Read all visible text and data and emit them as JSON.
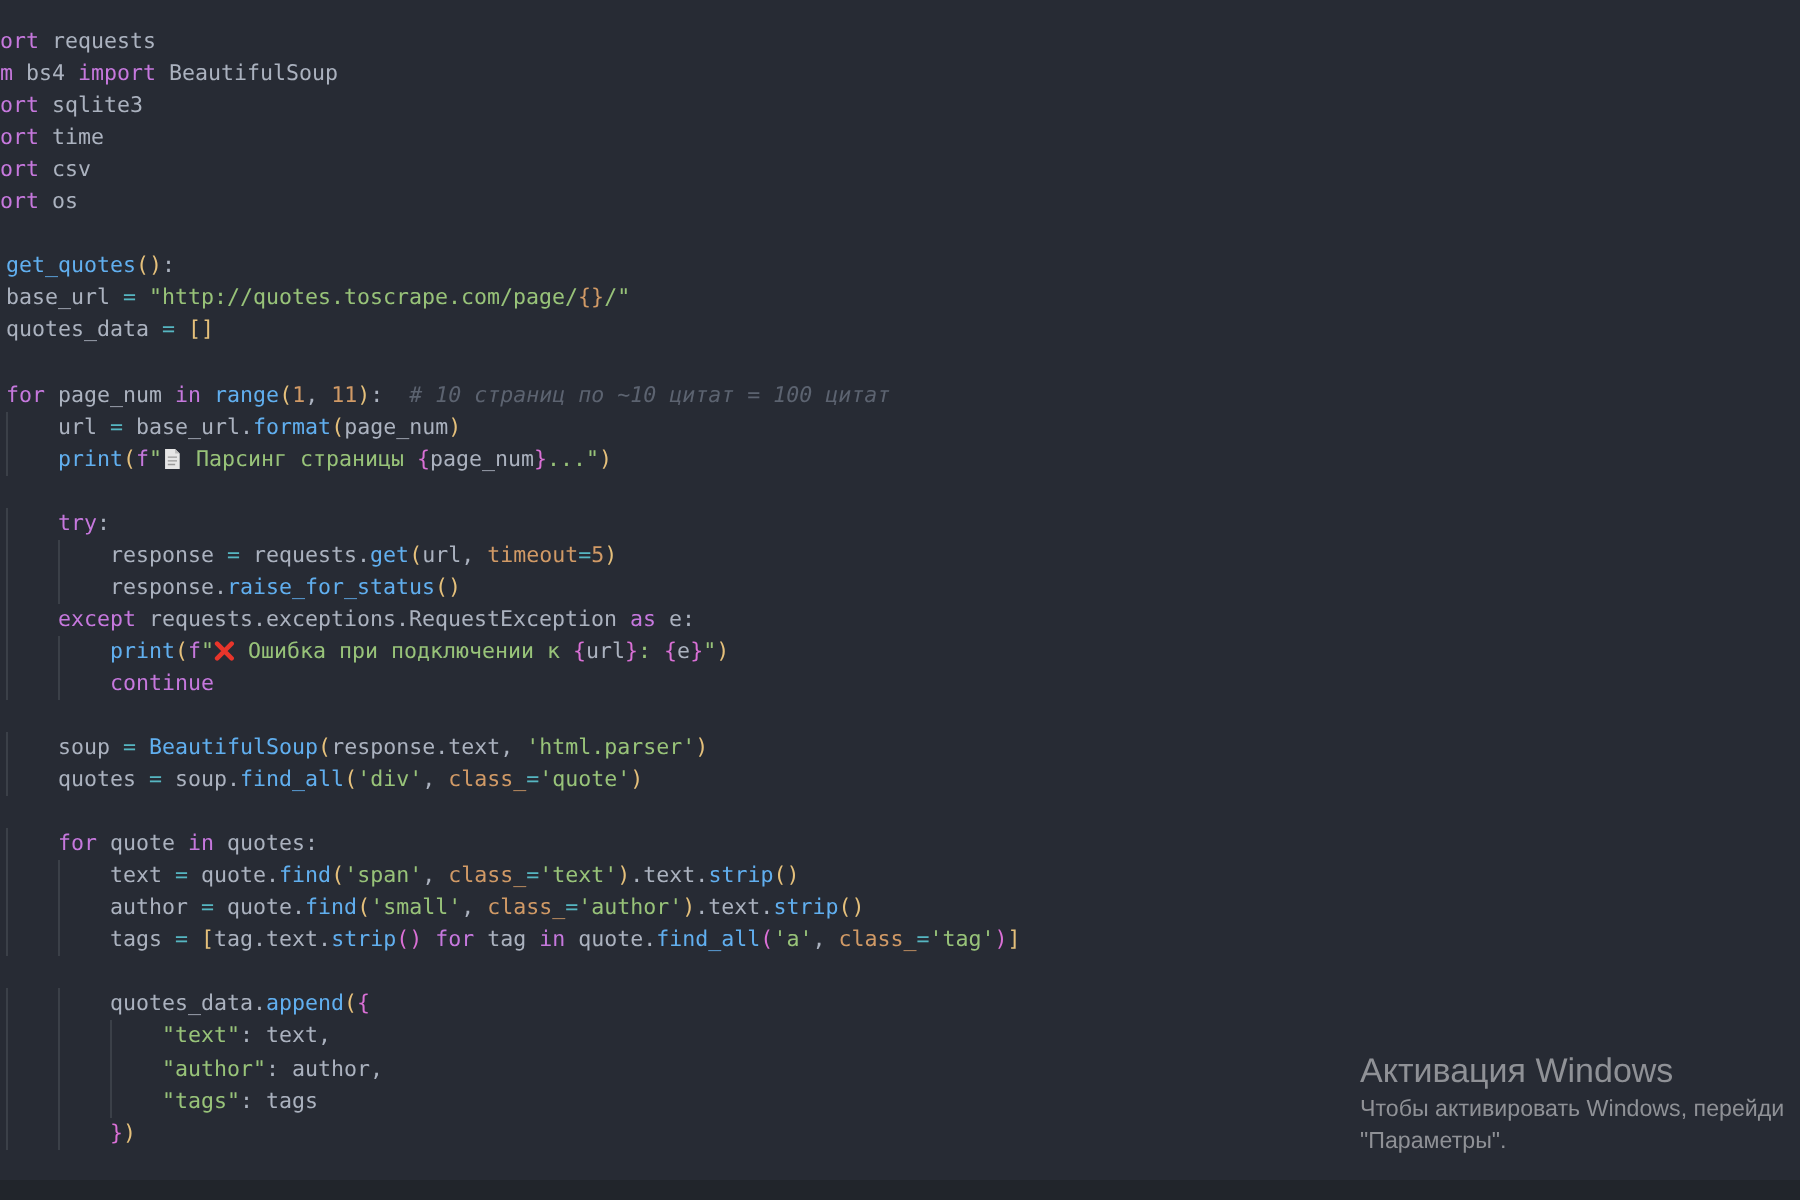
{
  "editor": {
    "lines": [
      {
        "kind": "clipped",
        "tokens": [
          {
            "kind": "k",
            "text": "ort"
          },
          {
            "kind": "t",
            "text": " requests"
          }
        ]
      },
      {
        "kind": "clipped",
        "tokens": [
          {
            "kind": "k",
            "text": "m"
          },
          {
            "kind": "t",
            "text": " bs4 "
          },
          {
            "kind": "k",
            "text": "import"
          },
          {
            "kind": "t",
            "text": " BeautifulSoup"
          }
        ]
      },
      {
        "kind": "clipped",
        "tokens": [
          {
            "kind": "k",
            "text": "ort"
          },
          {
            "kind": "t",
            "text": " sqlite3"
          }
        ]
      },
      {
        "kind": "clipped",
        "tokens": [
          {
            "kind": "k",
            "text": "ort"
          },
          {
            "kind": "t",
            "text": " time"
          }
        ]
      },
      {
        "kind": "clipped",
        "tokens": [
          {
            "kind": "k",
            "text": "ort"
          },
          {
            "kind": "t",
            "text": " csv"
          }
        ]
      },
      {
        "kind": "clipped",
        "tokens": [
          {
            "kind": "k",
            "text": "ort"
          },
          {
            "kind": "t",
            "text": " os"
          }
        ]
      },
      {
        "kind": "blank"
      },
      {
        "kind": "code",
        "tokens": [
          {
            "kind": "f",
            "text": "get_quotes"
          },
          {
            "kind": "b",
            "text": "()"
          },
          {
            "kind": "t",
            "text": ":"
          }
        ]
      },
      {
        "kind": "code",
        "tokens": [
          {
            "kind": "t",
            "text": "base_url "
          },
          {
            "kind": "o",
            "text": "="
          },
          {
            "kind": "s",
            "text": " \"http://quotes.toscrape.com/page/"
          },
          {
            "kind": "n",
            "text": "{}"
          },
          {
            "kind": "s",
            "text": "/\""
          }
        ]
      },
      {
        "kind": "code",
        "tokens": [
          {
            "kind": "t",
            "text": "quotes_data "
          },
          {
            "kind": "o",
            "text": "="
          },
          {
            "kind": "b",
            "text": " []"
          }
        ]
      },
      {
        "kind": "blank"
      },
      {
        "kind": "code",
        "tokens": [
          {
            "kind": "k",
            "text": "for"
          },
          {
            "kind": "t",
            "text": " page_num "
          },
          {
            "kind": "k",
            "text": "in"
          },
          {
            "kind": "f",
            "text": " range"
          },
          {
            "kind": "b",
            "text": "("
          },
          {
            "kind": "n",
            "text": "1"
          },
          {
            "kind": "t",
            "text": ", "
          },
          {
            "kind": "n",
            "text": "11"
          },
          {
            "kind": "b",
            "text": ")"
          },
          {
            "kind": "t",
            "text": ":  "
          },
          {
            "kind": "c",
            "text": "# 10 страниц по ~10 цитат = 100 цитат"
          }
        ]
      },
      {
        "kind": "code",
        "tokens": [
          {
            "kind": "t",
            "text": "    url "
          },
          {
            "kind": "o",
            "text": "="
          },
          {
            "kind": "t",
            "text": " base_url."
          },
          {
            "kind": "f",
            "text": "format"
          },
          {
            "kind": "b",
            "text": "("
          },
          {
            "kind": "t",
            "text": "page_num"
          },
          {
            "kind": "b",
            "text": ")"
          }
        ]
      },
      {
        "kind": "code",
        "tokens": [
          {
            "kind": "f",
            "text": "    print"
          },
          {
            "kind": "b",
            "text": "("
          },
          {
            "kind": "k",
            "text": "f"
          },
          {
            "kind": "s",
            "text": "\""
          },
          {
            "kind": "doc"
          },
          {
            "kind": "s",
            "text": " Парсинг страницы "
          },
          {
            "kind": "p",
            "text": "{"
          },
          {
            "kind": "t",
            "text": "page_num"
          },
          {
            "kind": "p",
            "text": "}"
          },
          {
            "kind": "s",
            "text": "...\""
          },
          {
            "kind": "b",
            "text": ")"
          }
        ]
      },
      {
        "kind": "blank"
      },
      {
        "kind": "code",
        "tokens": [
          {
            "kind": "k",
            "text": "    try"
          },
          {
            "kind": "t",
            "text": ":"
          }
        ]
      },
      {
        "kind": "code",
        "tokens": [
          {
            "kind": "t",
            "text": "        response "
          },
          {
            "kind": "o",
            "text": "="
          },
          {
            "kind": "t",
            "text": " requests."
          },
          {
            "kind": "f",
            "text": "get"
          },
          {
            "kind": "b",
            "text": "("
          },
          {
            "kind": "t",
            "text": "url, "
          },
          {
            "kind": "n",
            "text": "timeout"
          },
          {
            "kind": "o",
            "text": "="
          },
          {
            "kind": "n",
            "text": "5"
          },
          {
            "kind": "b",
            "text": ")"
          }
        ]
      },
      {
        "kind": "code",
        "tokens": [
          {
            "kind": "t",
            "text": "        response."
          },
          {
            "kind": "f",
            "text": "raise_for_status"
          },
          {
            "kind": "b",
            "text": "()"
          }
        ]
      },
      {
        "kind": "code",
        "tokens": [
          {
            "kind": "k",
            "text": "    except"
          },
          {
            "kind": "t",
            "text": " requests.exceptions.RequestException "
          },
          {
            "kind": "k",
            "text": "as"
          },
          {
            "kind": "t",
            "text": " e:"
          }
        ]
      },
      {
        "kind": "code",
        "tokens": [
          {
            "kind": "f",
            "text": "        print"
          },
          {
            "kind": "b",
            "text": "("
          },
          {
            "kind": "k",
            "text": "f"
          },
          {
            "kind": "s",
            "text": "\""
          },
          {
            "kind": "cross"
          },
          {
            "kind": "s",
            "text": " Ошибка при подключении к "
          },
          {
            "kind": "p",
            "text": "{"
          },
          {
            "kind": "t",
            "text": "url"
          },
          {
            "kind": "p",
            "text": "}"
          },
          {
            "kind": "s",
            "text": ": "
          },
          {
            "kind": "p",
            "text": "{"
          },
          {
            "kind": "t",
            "text": "e"
          },
          {
            "kind": "p",
            "text": "}"
          },
          {
            "kind": "s",
            "text": "\""
          },
          {
            "kind": "b",
            "text": ")"
          }
        ]
      },
      {
        "kind": "code",
        "tokens": [
          {
            "kind": "k",
            "text": "        continue"
          }
        ]
      },
      {
        "kind": "blank"
      },
      {
        "kind": "code",
        "tokens": [
          {
            "kind": "t",
            "text": "    soup "
          },
          {
            "kind": "o",
            "text": "="
          },
          {
            "kind": "f",
            "text": " BeautifulSoup"
          },
          {
            "kind": "b",
            "text": "("
          },
          {
            "kind": "t",
            "text": "response.text, "
          },
          {
            "kind": "s",
            "text": "'html.parser'"
          },
          {
            "kind": "b",
            "text": ")"
          }
        ]
      },
      {
        "kind": "code",
        "tokens": [
          {
            "kind": "t",
            "text": "    quotes "
          },
          {
            "kind": "o",
            "text": "="
          },
          {
            "kind": "t",
            "text": " soup."
          },
          {
            "kind": "f",
            "text": "find_all"
          },
          {
            "kind": "b",
            "text": "("
          },
          {
            "kind": "s",
            "text": "'div'"
          },
          {
            "kind": "t",
            "text": ", "
          },
          {
            "kind": "n",
            "text": "class_"
          },
          {
            "kind": "o",
            "text": "="
          },
          {
            "kind": "s",
            "text": "'quote'"
          },
          {
            "kind": "b",
            "text": ")"
          }
        ]
      },
      {
        "kind": "blank"
      },
      {
        "kind": "code",
        "tokens": [
          {
            "kind": "k",
            "text": "    for"
          },
          {
            "kind": "t",
            "text": " quote "
          },
          {
            "kind": "k",
            "text": "in"
          },
          {
            "kind": "t",
            "text": " quotes:"
          }
        ]
      },
      {
        "kind": "code",
        "tokens": [
          {
            "kind": "t",
            "text": "        text "
          },
          {
            "kind": "o",
            "text": "="
          },
          {
            "kind": "t",
            "text": " quote."
          },
          {
            "kind": "f",
            "text": "find"
          },
          {
            "kind": "b",
            "text": "("
          },
          {
            "kind": "s",
            "text": "'span'"
          },
          {
            "kind": "t",
            "text": ", "
          },
          {
            "kind": "n",
            "text": "class_"
          },
          {
            "kind": "o",
            "text": "="
          },
          {
            "kind": "s",
            "text": "'text'"
          },
          {
            "kind": "b",
            "text": ")"
          },
          {
            "kind": "t",
            "text": ".text."
          },
          {
            "kind": "f",
            "text": "strip"
          },
          {
            "kind": "b",
            "text": "()"
          }
        ]
      },
      {
        "kind": "code",
        "tokens": [
          {
            "kind": "t",
            "text": "        author "
          },
          {
            "kind": "o",
            "text": "="
          },
          {
            "kind": "t",
            "text": " quote."
          },
          {
            "kind": "f",
            "text": "find"
          },
          {
            "kind": "b",
            "text": "("
          },
          {
            "kind": "s",
            "text": "'small'"
          },
          {
            "kind": "t",
            "text": ", "
          },
          {
            "kind": "n",
            "text": "class_"
          },
          {
            "kind": "o",
            "text": "="
          },
          {
            "kind": "s",
            "text": "'author'"
          },
          {
            "kind": "b",
            "text": ")"
          },
          {
            "kind": "t",
            "text": ".text."
          },
          {
            "kind": "f",
            "text": "strip"
          },
          {
            "kind": "b",
            "text": "()"
          }
        ]
      },
      {
        "kind": "code",
        "tokens": [
          {
            "kind": "t",
            "text": "        tags "
          },
          {
            "kind": "o",
            "text": "="
          },
          {
            "kind": "b",
            "text": " ["
          },
          {
            "kind": "t",
            "text": "tag.text."
          },
          {
            "kind": "f",
            "text": "strip"
          },
          {
            "kind": "p",
            "text": "()"
          },
          {
            "kind": "k",
            "text": " for"
          },
          {
            "kind": "t",
            "text": " tag "
          },
          {
            "kind": "k",
            "text": "in"
          },
          {
            "kind": "t",
            "text": " quote."
          },
          {
            "kind": "f",
            "text": "find_all"
          },
          {
            "kind": "p",
            "text": "("
          },
          {
            "kind": "s",
            "text": "'a'"
          },
          {
            "kind": "t",
            "text": ", "
          },
          {
            "kind": "n",
            "text": "class_"
          },
          {
            "kind": "o",
            "text": "="
          },
          {
            "kind": "s",
            "text": "'tag'"
          },
          {
            "kind": "p",
            "text": ")"
          },
          {
            "kind": "b",
            "text": "]"
          }
        ]
      },
      {
        "kind": "blank"
      },
      {
        "kind": "code",
        "tokens": [
          {
            "kind": "t",
            "text": "        quotes_data."
          },
          {
            "kind": "f",
            "text": "append"
          },
          {
            "kind": "b",
            "text": "("
          },
          {
            "kind": "p",
            "text": "{"
          }
        ]
      },
      {
        "kind": "code",
        "tokens": [
          {
            "kind": "s",
            "text": "            \"text\""
          },
          {
            "kind": "t",
            "text": ": text,"
          }
        ]
      },
      {
        "kind": "code",
        "tokens": [
          {
            "kind": "s",
            "text": "            \"author\""
          },
          {
            "kind": "t",
            "text": ": author,"
          }
        ]
      },
      {
        "kind": "code",
        "tokens": [
          {
            "kind": "s",
            "text": "            \"tags\""
          },
          {
            "kind": "t",
            "text": ": tags"
          }
        ]
      },
      {
        "kind": "code",
        "tokens": [
          {
            "kind": "p",
            "text": "        }"
          },
          {
            "kind": "b",
            "text": ")"
          }
        ]
      }
    ]
  },
  "activation_notice": {
    "title": "Активация Windows",
    "lines": [
      "Чтобы активировать Windows, перейди",
      "\"Параметры\"."
    ]
  }
}
